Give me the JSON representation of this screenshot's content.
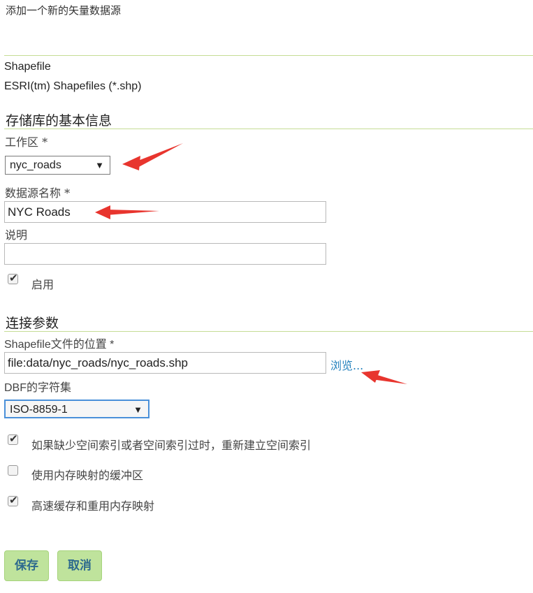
{
  "page": {
    "title": "添加一个新的矢量数据源",
    "store_type": "Shapefile",
    "store_description": "ESRI(tm) Shapefiles (*.shp)"
  },
  "basic_info": {
    "section_title": "存储库的基本信息",
    "workspace_label": "工作区 *",
    "workspace_value": "nyc_roads",
    "name_label": "数据源名称 *",
    "name_value": "NYC Roads",
    "description_label": "说明",
    "description_value": "",
    "enabled_label": "启用",
    "enabled_checked": true
  },
  "connection": {
    "section_title": "连接参数",
    "location_label": "Shapefile文件的位置 *",
    "location_value": "file:data/nyc_roads/nyc_roads.shp",
    "browse_label": "浏览...",
    "charset_label": "DBF的字符集",
    "charset_value": "ISO-8859-1",
    "options": [
      {
        "label": "如果缺少空间索引或者空间索引过时，重新建立空间索引",
        "checked": true
      },
      {
        "label": "使用内存映射的缓冲区",
        "checked": false
      },
      {
        "label": "高速缓存和重用内存映射",
        "checked": true
      }
    ]
  },
  "actions": {
    "save_label": "保存",
    "cancel_label": "取消"
  },
  "colors": {
    "accent_line": "#c5dc95",
    "button_bg": "#bfe39c",
    "button_text": "#2d6a8e",
    "link": "#2582bd",
    "annotation_arrow": "#e8352e"
  },
  "icons": {
    "dropdown": "triangle-down",
    "checkbox": "check-mark"
  }
}
